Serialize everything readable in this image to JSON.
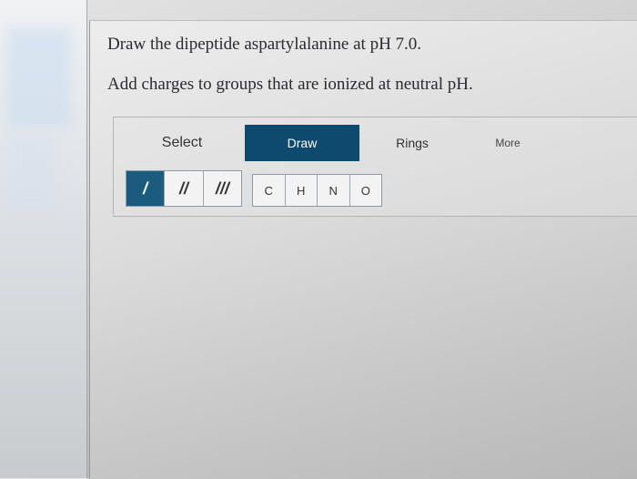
{
  "question": {
    "line1": "Draw the dipeptide aspartylalanine at pH 7.0.",
    "line2": "Add charges to groups that are ionized at neutral pH."
  },
  "toolbar": {
    "tabs": [
      {
        "label": "Select",
        "active": false
      },
      {
        "label": "Draw",
        "active": true
      },
      {
        "label": "Rings",
        "active": false
      },
      {
        "label": "More",
        "active": false
      }
    ],
    "bonds": [
      {
        "label": "/",
        "icon": "single-bond-icon",
        "active": true
      },
      {
        "label": "//",
        "icon": "double-bond-icon",
        "active": false
      },
      {
        "label": "///",
        "icon": "triple-bond-icon",
        "active": false
      }
    ],
    "atoms": [
      "C",
      "H",
      "N",
      "O"
    ]
  },
  "colors": {
    "active_tab": "#0e4a6d",
    "active_bond": "#1b5b7e"
  }
}
